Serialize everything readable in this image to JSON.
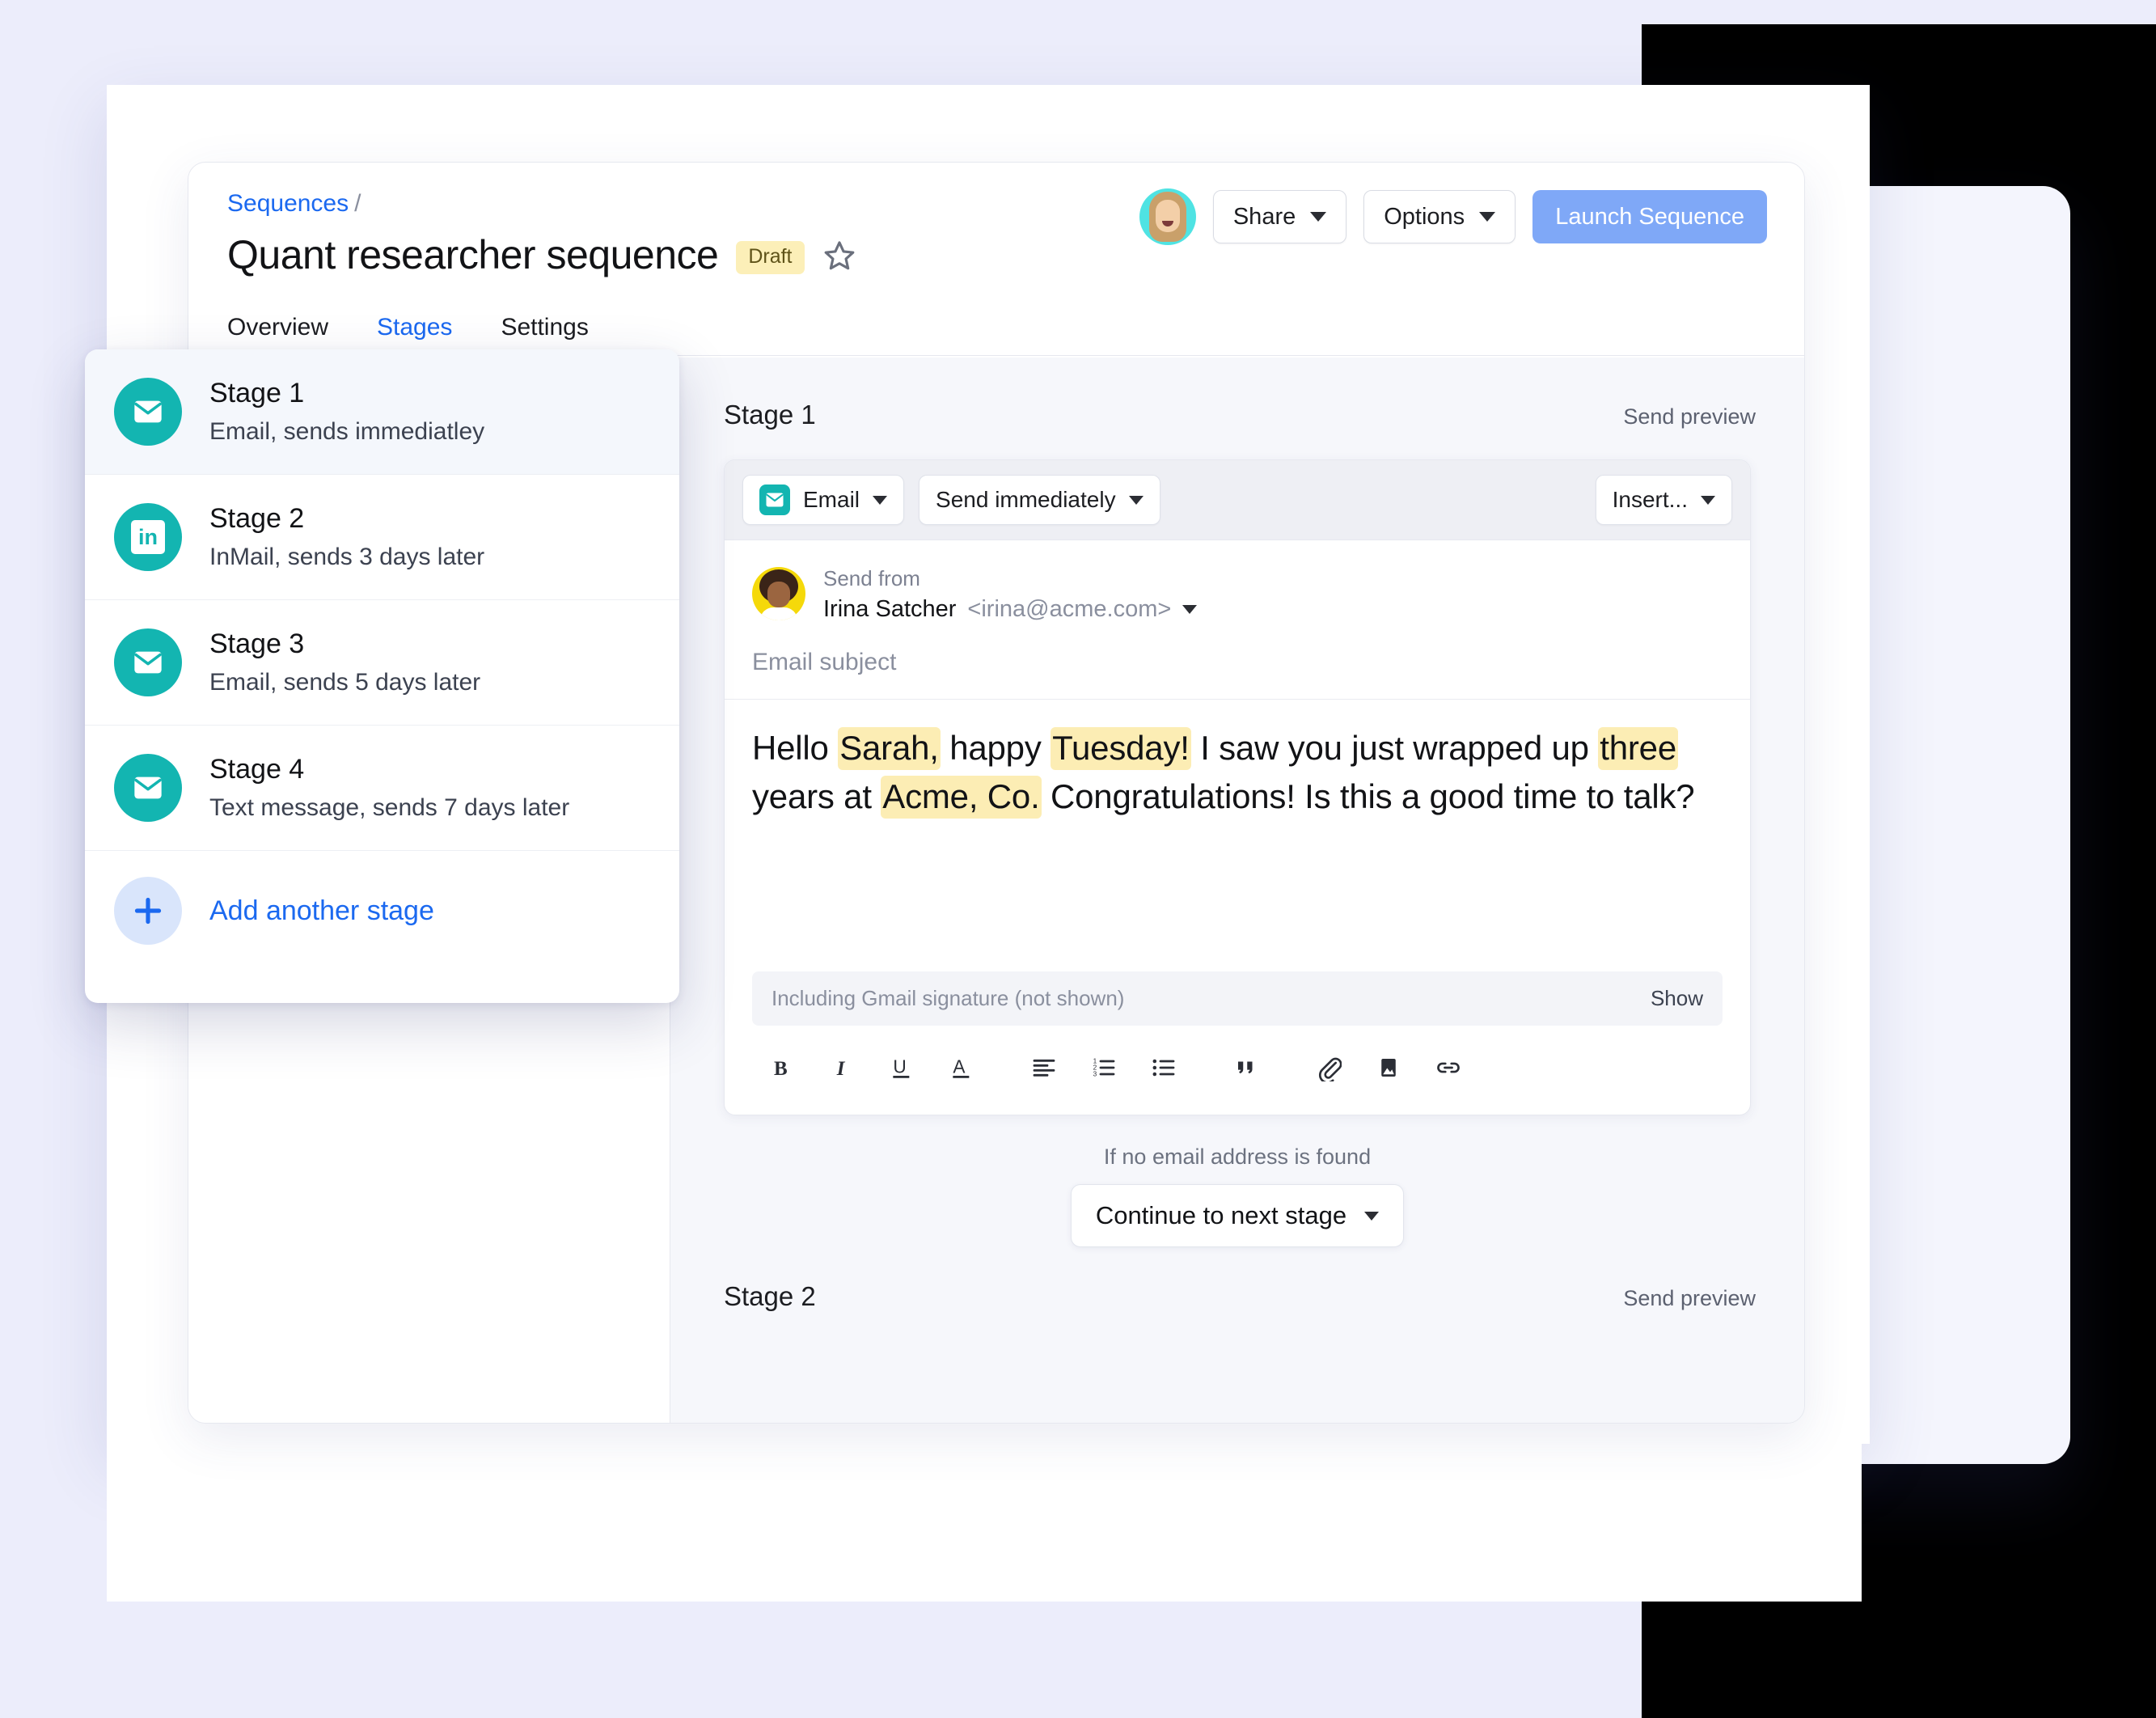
{
  "breadcrumb": {
    "link": "Sequences",
    "separator": "/"
  },
  "header": {
    "title": "Quant researcher sequence",
    "status_badge": "Draft",
    "star_icon": "star-outline-icon",
    "avatar_icon": "user-avatar",
    "share_label": "Share",
    "options_label": "Options",
    "launch_label": "Launch Sequence",
    "accent_blue": "#1B69F0",
    "primary_button_color": "#7FA8F7",
    "badge_bg": "#FCEFB8"
  },
  "tabs": [
    {
      "label": "Overview",
      "active": false
    },
    {
      "label": "Stages",
      "active": true
    },
    {
      "label": "Settings",
      "active": false
    }
  ],
  "stages_panel": {
    "items": [
      {
        "title": "Stage 1",
        "subtitle": "Email, sends immediatley",
        "icon": "envelope-icon",
        "selected": true
      },
      {
        "title": "Stage 2",
        "subtitle": "InMail, sends 3 days later",
        "icon": "linkedin-icon",
        "selected": false
      },
      {
        "title": "Stage 3",
        "subtitle": "Email, sends 5 days later",
        "icon": "envelope-icon",
        "selected": false
      },
      {
        "title": "Stage 4",
        "subtitle": "Text message, sends 7 days later",
        "icon": "envelope-icon",
        "selected": false
      }
    ],
    "add_label": "Add another stage",
    "add_icon": "plus-icon",
    "icon_color": "#13B5B1"
  },
  "editor": {
    "stage_heading": "Stage 1",
    "send_preview": "Send preview",
    "channel_label": "Email",
    "timing_label": "Send immediately",
    "insert_label": "Insert...",
    "send_from_label": "Send from",
    "sender_name": "Irina Satcher",
    "sender_email": "<irina@acme.com>",
    "subject_placeholder": "Email subject",
    "body": {
      "segments": [
        {
          "text": "Hello ",
          "highlight": false
        },
        {
          "text": "Sarah,",
          "highlight": true
        },
        {
          "text": " happy ",
          "highlight": false
        },
        {
          "text": "Tuesday!",
          "highlight": true
        },
        {
          "text": " I saw you just wrapped up ",
          "highlight": false
        },
        {
          "text": "three",
          "highlight": true
        },
        {
          "text": " years at ",
          "highlight": false
        },
        {
          "text": "Acme, Co.",
          "highlight": true
        },
        {
          "text": " Congratulations! Is this a good time to talk?",
          "highlight": false
        }
      ],
      "highlight_color": "#FCEDB4"
    },
    "signature_text": "Including Gmail signature (not shown)",
    "signature_show": "Show",
    "format_buttons": [
      {
        "icon": "bold-icon",
        "label": "B"
      },
      {
        "icon": "italic-icon",
        "label": "I"
      },
      {
        "icon": "underline-icon",
        "label": "U"
      },
      {
        "icon": "text-color-icon",
        "label": "A"
      },
      {
        "icon": "align-left-icon",
        "label": ""
      },
      {
        "icon": "ordered-list-icon",
        "label": ""
      },
      {
        "icon": "bulleted-list-icon",
        "label": ""
      },
      {
        "icon": "blockquote-icon",
        "label": ""
      },
      {
        "icon": "attachment-icon",
        "label": ""
      },
      {
        "icon": "image-icon",
        "label": ""
      },
      {
        "icon": "link-icon",
        "label": ""
      }
    ]
  },
  "fallback": {
    "label": "If no email address is found",
    "action": "Continue to next stage"
  },
  "next_stage": {
    "heading": "Stage 2",
    "send_preview": "Send preview"
  }
}
